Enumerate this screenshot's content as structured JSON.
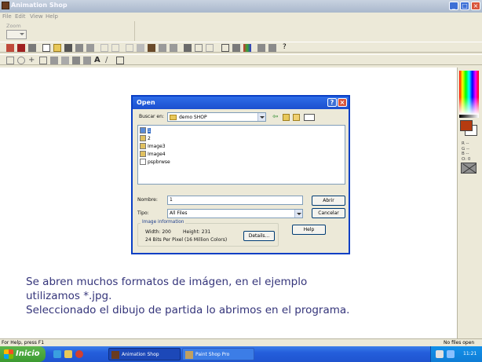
{
  "app": {
    "title": "Animation Shop",
    "menu": [
      "File",
      "Edit",
      "View",
      "Help"
    ],
    "zoom_label": "Zoom"
  },
  "dialog": {
    "title": "Open",
    "look_in_label": "Buscar en:",
    "look_in_value": "demo SHOP",
    "files": [
      {
        "name": "1",
        "selected": true
      },
      {
        "name": "2",
        "selected": false
      },
      {
        "name": "Image3",
        "selected": false
      },
      {
        "name": "Image4",
        "selected": false
      },
      {
        "name": "pspbrwse",
        "selected": false
      }
    ],
    "name_label": "Nombre:",
    "name_value": "1",
    "type_label": "Tipo:",
    "type_value": "All Files",
    "open_button": "Abrir",
    "cancel_button": "Cancelar",
    "help_button": "Help",
    "details_button": "Details...",
    "image_info": {
      "title": "Image information",
      "width": "Width: 200",
      "height": "Height: 231",
      "depth": "24 Bits Per Pixel (16 Million Colors)"
    }
  },
  "colors": {
    "foreground": "#b63b10",
    "background": "#ffffff",
    "rgb_lines": [
      "R --",
      "G --",
      "B --",
      "O: 0"
    ]
  },
  "caption": [
    "Se abren muchos formatos de imágen, en el ejemplo",
    "utilizamos *.jpg.",
    "Seleccionado el dibujo de partida lo abrimos en el programa."
  ],
  "status": {
    "left": "For Help, press F1",
    "right": "No files open"
  },
  "taskbar": {
    "start": "Inicio",
    "tasks": [
      "Animation Shop",
      "Paint Shop Pro"
    ],
    "clock": "11:21"
  }
}
